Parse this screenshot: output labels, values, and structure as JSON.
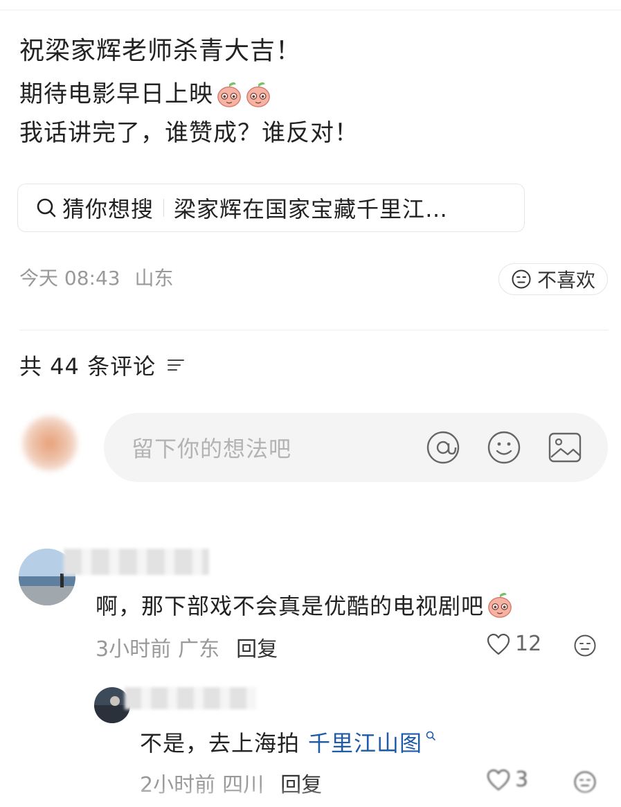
{
  "post": {
    "title_line": "祝梁家辉老师杀青大吉！",
    "line2": "期待电影早日上映",
    "line2_emoji": [
      "peach-emoji",
      "peach-emoji"
    ],
    "line3": "我话讲完了，谁赞成？谁反对！"
  },
  "search_hint": {
    "icon": "search-icon",
    "label": "猜你想搜",
    "query": "梁家辉在国家宝藏千里江…"
  },
  "post_meta": {
    "time": "今天 08:43",
    "location": "山东"
  },
  "dislike_button": {
    "icon": "meh-face-icon",
    "label": "不喜欢"
  },
  "comments_header": {
    "label": "共 44 条评论",
    "icon": "sort-icon"
  },
  "comment_input": {
    "placeholder": "留下你的想法吧",
    "icons": [
      "at-icon",
      "emoji-icon",
      "image-icon"
    ]
  },
  "comments": [
    {
      "text": "啊，那下部戏不会真是优酷的电视剧吧",
      "emoji": "peach-emoji",
      "time": "3小时前",
      "location": "广东",
      "reply_label": "回复",
      "likes": "12",
      "replies": [
        {
          "text_prefix": "不是，去上海拍",
          "link_text": "千里江山图",
          "time": "2小时前",
          "location": "四川",
          "reply_label": "回复",
          "likes": "3"
        }
      ]
    }
  ],
  "colors": {
    "text": "#222222",
    "muted": "#999999",
    "link": "#1e5aa8",
    "input_bg": "#f4f4f4",
    "border": "#e6e6e6"
  }
}
